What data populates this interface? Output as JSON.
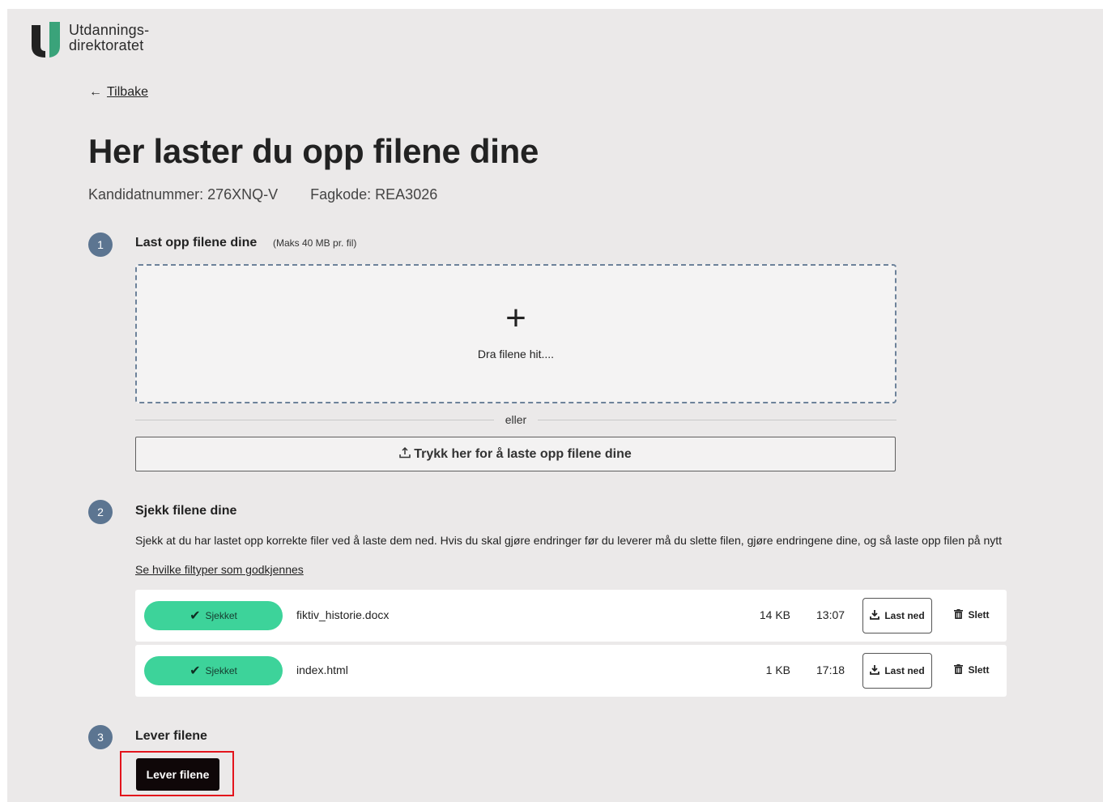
{
  "brand": {
    "logo_line1": "Utdannings-",
    "logo_line2": "direktoratet",
    "logo_dark": "#222222",
    "logo_green": "#3aa37a"
  },
  "nav": {
    "back_arrow": "←",
    "back_label": "Tilbake"
  },
  "page": {
    "title": "Her laster du opp filene dine",
    "candidate": "Kandidatnummer: 276XNQ-V",
    "subject": "Fagkode: REA3026"
  },
  "step1": {
    "number": "1",
    "title": "Last opp filene dine",
    "note": "(Maks 40 MB pr. fil)",
    "dropzone_icon": "+",
    "dropzone_hint": "Dra filene hit....",
    "or": "eller",
    "upload_icon": "upload-icon",
    "upload_label": "Trykk her for å laste opp filene dine"
  },
  "step2": {
    "number": "2",
    "title": "Sjekk filene dine",
    "description": "Sjekk at du har lastet opp korrekte filer ved å laste dem ned. Hvis du skal gjøre endringer før du leverer må du slette filen, gjøre endringene dine, og så laste opp filen på nytt",
    "filetypes_link": "Se hvilke filtyper som godkjennes",
    "files": [
      {
        "status": "Sjekket",
        "name": "fiktiv_historie.docx",
        "size": "14 KB",
        "time": "13:07",
        "download": "Last ned",
        "delete": "Slett"
      },
      {
        "status": "Sjekket",
        "name": "index.html",
        "size": "1 KB",
        "time": "17:18",
        "download": "Last ned",
        "delete": "Slett"
      }
    ]
  },
  "step3": {
    "number": "3",
    "title": "Lever filene",
    "submit_label": "Lever filene"
  },
  "colors": {
    "step_badge": "#5c7591",
    "status_ok": "#3dd39a",
    "highlight": "#e3141c",
    "submit_bg": "#0f0708"
  }
}
